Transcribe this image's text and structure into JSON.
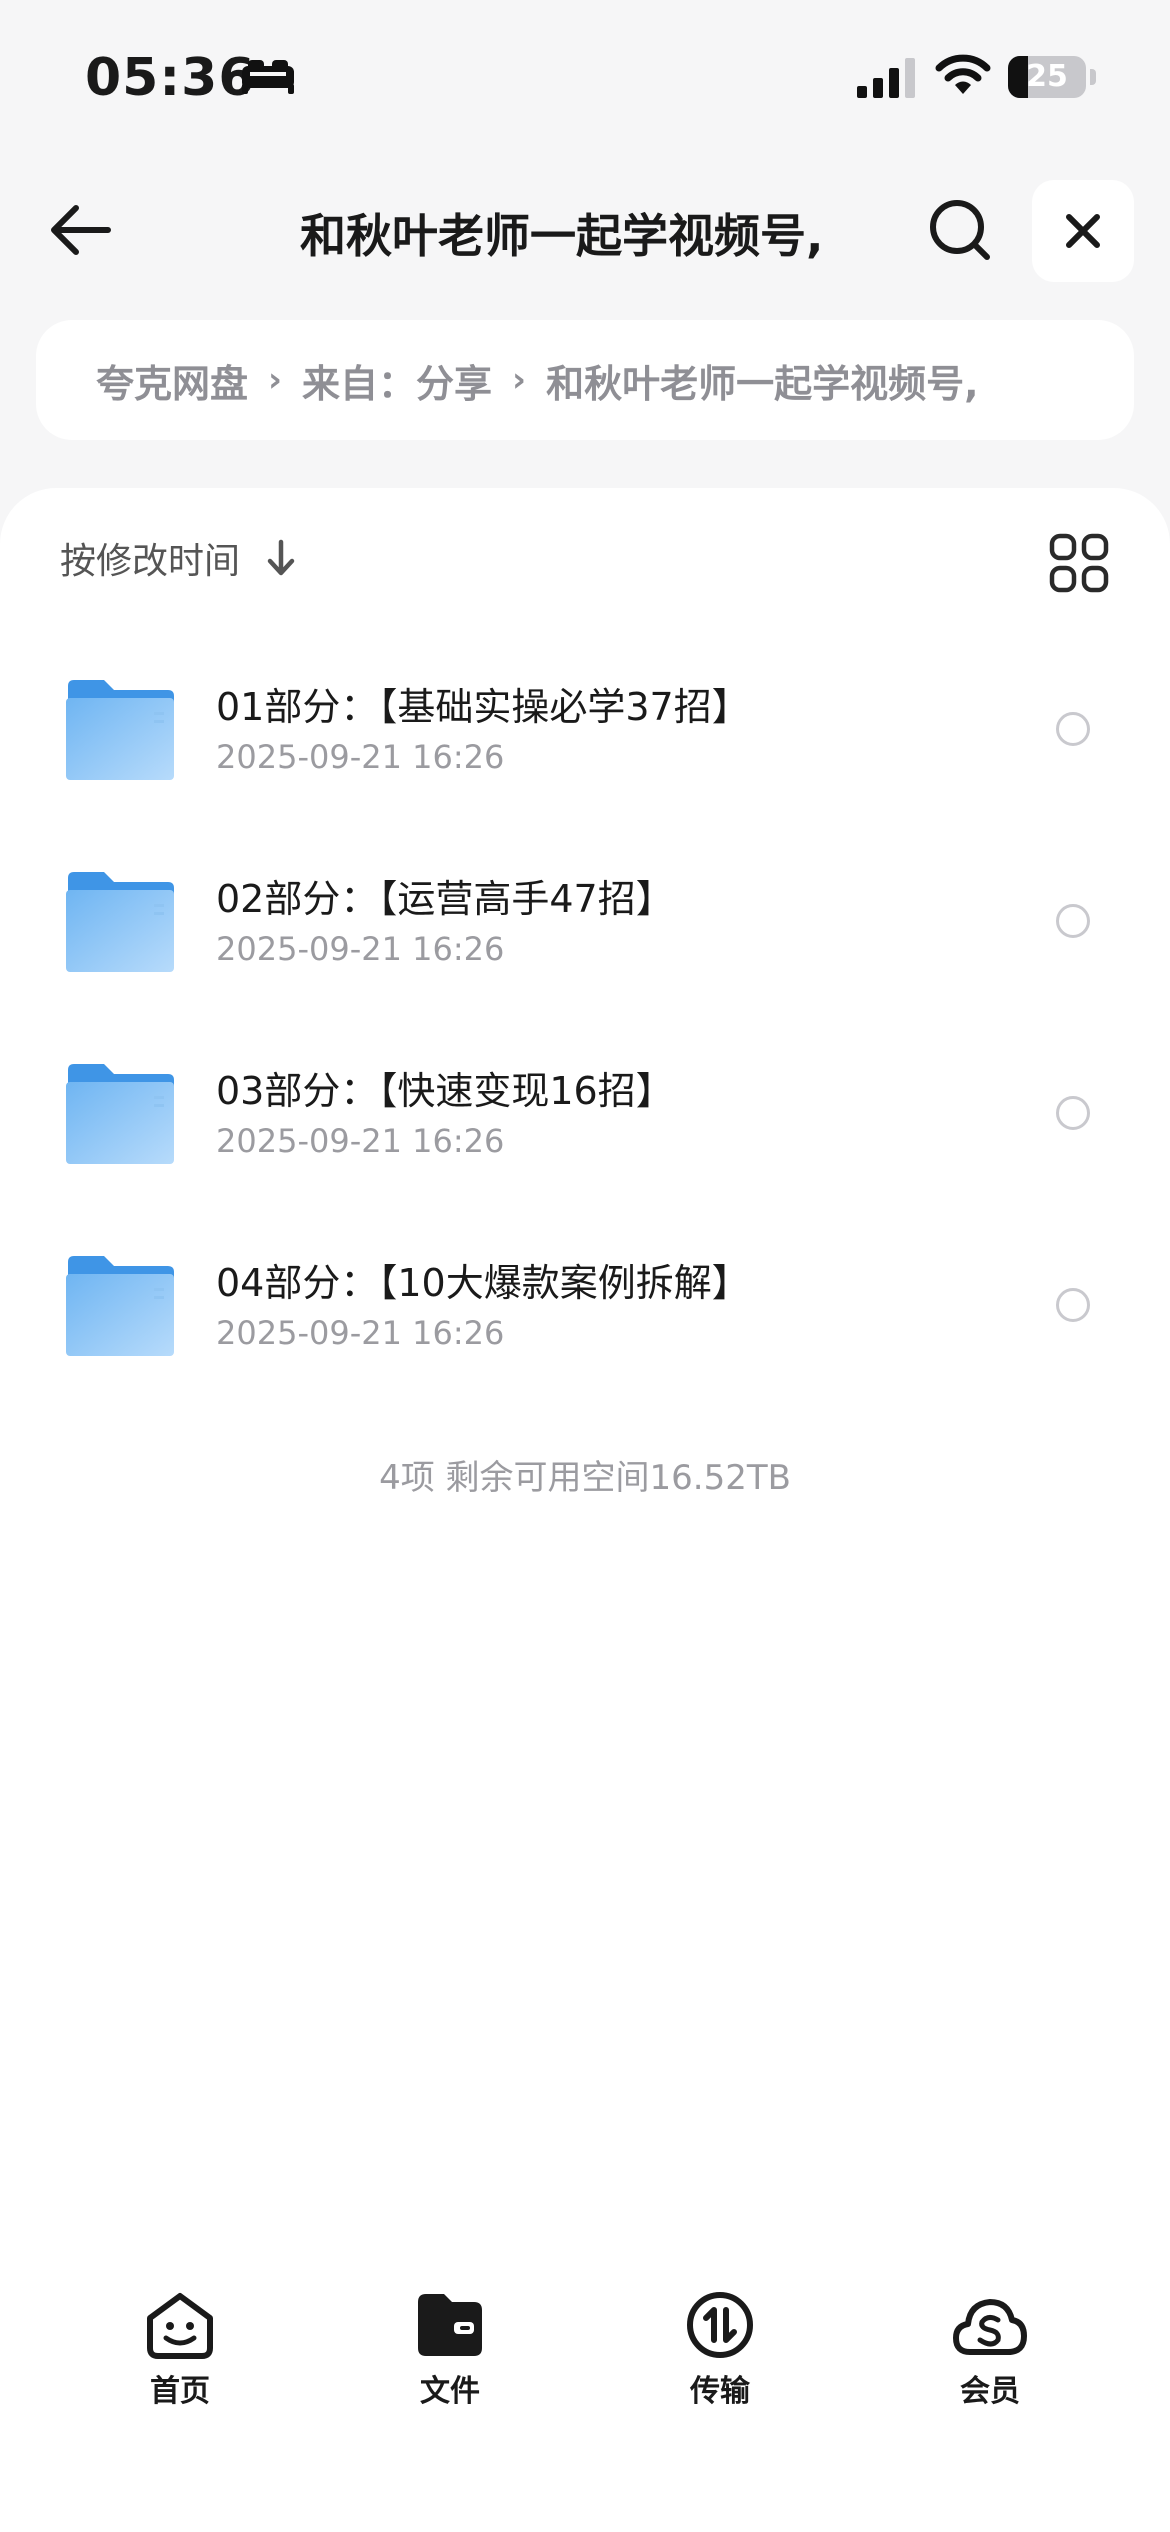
{
  "status_bar": {
    "time": "05:36",
    "battery_level": "25",
    "battery_fraction": 0.25,
    "icons": [
      "sleep-focus-icon",
      "cellular-signal-icon",
      "wifi-icon",
      "battery-icon"
    ]
  },
  "header": {
    "title": "和秋叶老师一起学视频号,",
    "icons": [
      "back-arrow-icon",
      "search-icon",
      "close-icon"
    ]
  },
  "breadcrumb": {
    "items": [
      "夸克网盘",
      "来自：分享",
      "和秋叶老师一起学视频号,"
    ],
    "separator": "›"
  },
  "toolbar": {
    "sort_label": "按修改时间",
    "icons": [
      "sort-down-arrow-icon",
      "grid-view-icon"
    ]
  },
  "files": [
    {
      "name": "01部分：【基础实操必学37招】",
      "date": "2025-09-21 16:26",
      "type": "folder"
    },
    {
      "name": "02部分：【运营高手47招】",
      "date": "2025-09-21 16:26",
      "type": "folder"
    },
    {
      "name": "03部分：【快速变现16招】",
      "date": "2025-09-21 16:26",
      "type": "folder"
    },
    {
      "name": "04部分：【10大爆款案例拆解】",
      "date": "2025-09-21 16:26",
      "type": "folder"
    }
  ],
  "summary": "4项 剩余可用空间16.52TB",
  "tabs": [
    {
      "label": "首页",
      "icon": "home-smile-icon",
      "active": false
    },
    {
      "label": "文件",
      "icon": "files-folder-icon",
      "active": true
    },
    {
      "label": "传输",
      "icon": "transfer-icon",
      "active": false
    },
    {
      "label": "会员",
      "icon": "member-cloud-icon",
      "active": false
    }
  ],
  "colors": {
    "background": "#f6f6f7",
    "card": "#ffffff",
    "folder_blue": "#5aa9ef",
    "secondary_text": "#9b9ba0",
    "primary_text": "#1a1a1a"
  }
}
